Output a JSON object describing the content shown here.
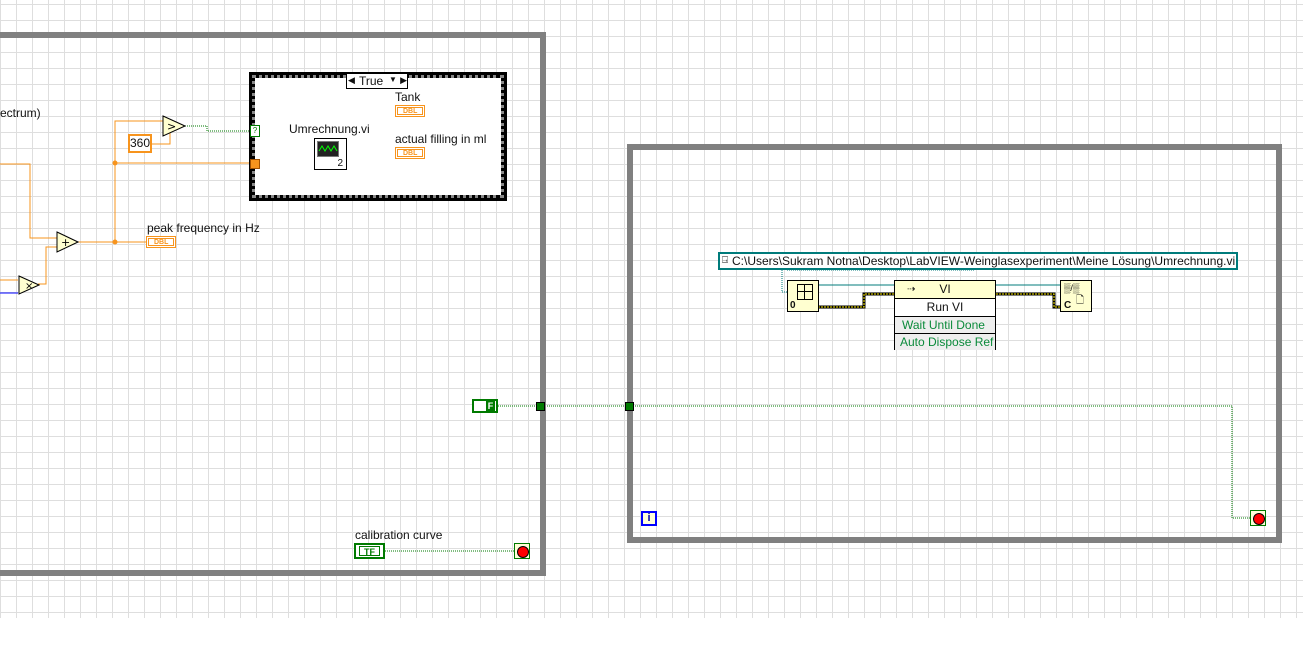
{
  "left_loop": {
    "truncated_label": "ectrum)",
    "constant_360": "360",
    "case_structure": {
      "selector": "True"
    },
    "subvi_label": "Umrechnung.vi",
    "subvi_terminal": "2",
    "indicators": {
      "tank": "Tank",
      "actual_filling": "actual filling in ml",
      "peak_frequency": "peak frequency in Hz",
      "type": "DBL"
    },
    "calibration_curve": {
      "label": "calibration curve",
      "type": "TF"
    },
    "false_constant": "F"
  },
  "right_loop": {
    "path_constant": "C:\\Users\\Sukram Notna\\Desktop\\LabVIEW-Weinglasexperiment\\Meine Lösung\\Umrechnung.vi",
    "open_ref_terminal": "0",
    "invoke_node": {
      "class": "VI",
      "method": "Run VI",
      "params": [
        "Wait Until Done",
        "Auto Dispose Ref"
      ]
    },
    "close_ref_label": "C",
    "iteration_terminal": "i"
  },
  "colors": {
    "loop_border": "#808080",
    "numeric_wire": "#f7941d",
    "boolean_wire": "#007a00",
    "refnum_wire": "#007b7b",
    "grid": "#dedede"
  }
}
